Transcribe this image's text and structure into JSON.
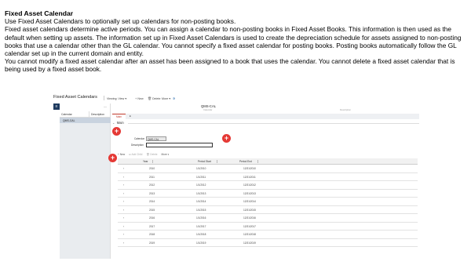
{
  "doc": {
    "title": "Fixed Asset Calendar",
    "paragraphs": [
      "Use Fixed Asset Calendars to optionally set up calendars for non-posting books.",
      "Fixed asset calendars determine active periods. You can assign a calendar to non-posting books in Fixed Asset Books. This information is then used as the default when setting up assets. The information set up in Fixed Asset Calendars is used to create the depreciation schedule for assets assigned to non-posting books that use a calendar other than the GL calendar. You cannot specify a fixed asset calendar for posting books. Posting books automatically follow the GL calendar set up in the current domain and entity.",
      "You cannot modify a fixed asset calendar after an asset has been assigned to a book that uses the calendar. You cannot delete a fixed asset calendar that is being used by a fixed asset book."
    ]
  },
  "app": {
    "title": "Fixed Asset Calendars",
    "toolbar": {
      "viewing": "Viewing: View",
      "new": "New",
      "delete": "Delete",
      "more": "More"
    },
    "hamburger_icon": "menu-icon",
    "left_panel": {
      "headers": [
        "Calendar",
        "Description"
      ],
      "selected_row": "QMS-CAL"
    },
    "record": {
      "calendar_name": "QMS-CAL",
      "calendar_label": "Calendar",
      "description_label": "Description"
    },
    "tabs": [
      "Main"
    ],
    "section": "Main",
    "fields": {
      "calendar_label": "Calendar",
      "calendar_value": "QMS-CAL",
      "description_label": "Description",
      "description_value": ""
    },
    "grid_toolbar": {
      "new": "New",
      "add_child": "Add Child",
      "delete": "Delete",
      "more": "More"
    },
    "grid": {
      "headers": [
        "Year",
        "Period Start",
        "Period End"
      ],
      "rows": [
        {
          "year": "2010",
          "start": "1/1/2010",
          "end": "12/31/2010"
        },
        {
          "year": "2011",
          "start": "1/1/2011",
          "end": "12/31/2011"
        },
        {
          "year": "2012",
          "start": "1/1/2012",
          "end": "12/31/2012"
        },
        {
          "year": "2013",
          "start": "1/1/2013",
          "end": "12/31/2013"
        },
        {
          "year": "2014",
          "start": "1/1/2014",
          "end": "12/31/2014"
        },
        {
          "year": "2015",
          "start": "1/1/2015",
          "end": "12/31/2015"
        },
        {
          "year": "2016",
          "start": "1/1/2016",
          "end": "12/31/2016"
        },
        {
          "year": "2017",
          "start": "1/1/2017",
          "end": "12/31/2017"
        },
        {
          "year": "2018",
          "start": "1/1/2018",
          "end": "12/31/2018"
        },
        {
          "year": "2019",
          "start": "1/1/2019",
          "end": "12/31/2019"
        }
      ]
    },
    "colors": {
      "accent": "#e53935",
      "nav_dark": "#1e3a5f",
      "selected_row": "#c9d3df"
    }
  }
}
